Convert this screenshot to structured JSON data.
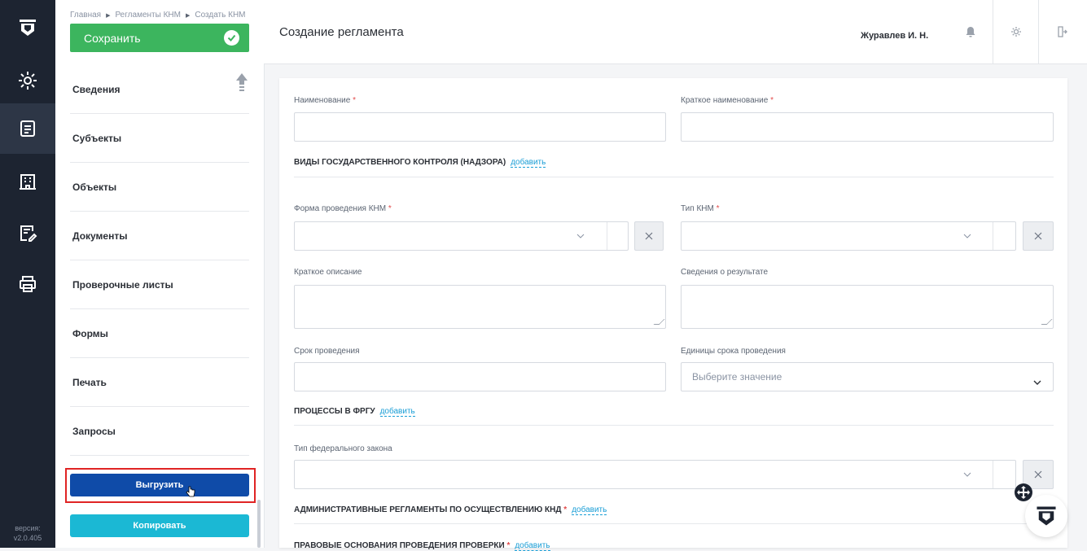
{
  "breadcrumb": [
    "Главная",
    "Регламенты КНМ",
    "Создать КНМ"
  ],
  "toolbar": {
    "save_label": "Сохранить"
  },
  "header": {
    "title": "Создание регламента",
    "user": "Журавлев И. Н."
  },
  "sidebar": {
    "items": [
      {
        "label": "Сведения"
      },
      {
        "label": "Субъекты"
      },
      {
        "label": "Объекты"
      },
      {
        "label": "Документы"
      },
      {
        "label": "Проверочные листы"
      },
      {
        "label": "Формы"
      },
      {
        "label": "Печать"
      },
      {
        "label": "Запросы"
      }
    ],
    "export_label": "Выгрузить",
    "copy_label": "Копировать"
  },
  "rail": {
    "icons": [
      "settings-icon",
      "document-list-icon",
      "building-icon",
      "edit-document-icon",
      "print-icon"
    ],
    "version_label": "версия:",
    "version": "v2.0.405"
  },
  "form": {
    "name_label": "Наименование",
    "short_name_label": "Краткое наименование",
    "control_types_section": "ВИДЫ ГОСУДАРСТВЕННОГО КОНТРОЛЯ (НАДЗОРА)",
    "add_link": "добавить",
    "form_knm_label": "Форма проведения КНМ",
    "type_knm_label": "Тип КНМ",
    "short_desc_label": "Краткое описание",
    "result_label": "Сведения о результате",
    "term_label": "Срок проведения",
    "term_units_label": "Единицы срока проведения",
    "term_units_placeholder": "Выберите значение",
    "processes_section": "ПРОЦЕССЫ В ФРГУ",
    "fed_law_label": "Тип федерального закона",
    "admin_regs_section": "АДМИНИСТРАТИВНЫЕ РЕГЛАМЕНТЫ ПО ОСУЩЕСТВЛЕНИЮ КНД",
    "legal_basis_section": "ПРАВОВЫЕ ОСНОВАНИЯ ПРОВЕДЕНИЯ ПРОВЕРКИ",
    "required_mark": "*"
  }
}
